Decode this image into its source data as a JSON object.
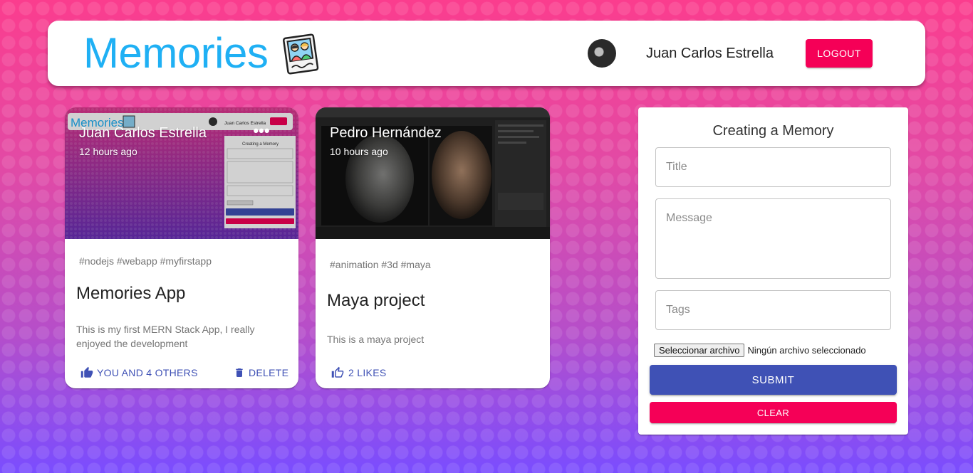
{
  "header": {
    "brand": "Memories",
    "brand_color": "#1fb0f4",
    "user_name": "Juan Carlos Estrella",
    "logout_label": "LOGOUT"
  },
  "posts": [
    {
      "creator": "Juan Carlos Estrella",
      "time": "12 hours ago",
      "tags": "#nodejs #webapp #myfirstapp",
      "title": "Memories App",
      "message": "This is my first MERN Stack App, I really enjoyed the development",
      "like_label": "YOU AND 4 OTHERS",
      "delete_label": "DELETE",
      "thumbnail": {
        "brand": "Memories",
        "user": "Juan Carlos Estrella",
        "form_title": "Creating a Memory"
      }
    },
    {
      "creator": "Pedro Hernández",
      "time": "10 hours ago",
      "tags": "#animation #3d #maya",
      "title": "Maya project",
      "message": "This is a maya project",
      "like_label": "2 LIKES"
    }
  ],
  "form": {
    "title": "Creating a Memory",
    "title_placeholder": "Title",
    "message_placeholder": "Message",
    "tags_placeholder": "Tags",
    "file_button": "Seleccionar archivo",
    "file_status": "Ningún archivo seleccionado",
    "submit_label": "SUBMIT",
    "clear_label": "CLEAR"
  },
  "colors": {
    "primary": "#3f51b5",
    "secondary": "#f50057"
  }
}
